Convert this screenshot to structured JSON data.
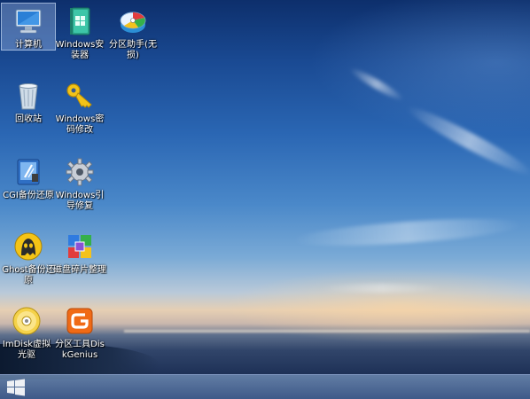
{
  "desktop": {
    "icons": [
      {
        "label": "计算机",
        "icon": "computer-icon"
      },
      {
        "label": "Windows安装器",
        "icon": "windows-installer-icon"
      },
      {
        "label": "分区助手(无损)",
        "icon": "partition-assistant-icon"
      },
      {
        "label": "回收站",
        "icon": "recycle-bin-icon"
      },
      {
        "label": "Windows密码修改",
        "icon": "key-icon"
      },
      {
        "label": "CGI备份还原",
        "icon": "cgi-backup-icon"
      },
      {
        "label": "Windows引导修复",
        "icon": "gear-icon"
      },
      {
        "label": "Ghost备份还原",
        "icon": "ghost-icon"
      },
      {
        "label": "磁盘碎片整理",
        "icon": "defrag-icon"
      },
      {
        "label": "ImDisk虚拟光驱",
        "icon": "virtual-cd-icon"
      },
      {
        "label": "分区工具DiskGenius",
        "icon": "diskgenius-icon"
      }
    ]
  },
  "taskbar": {
    "start_icon": "windows-logo-icon"
  },
  "colors": {
    "sky_top": "#0d2f6c",
    "sky_mid": "#4a88c9",
    "horizon": "#e6cfb3",
    "sea": "#1f3258",
    "taskbar": "#6a8cbc"
  }
}
